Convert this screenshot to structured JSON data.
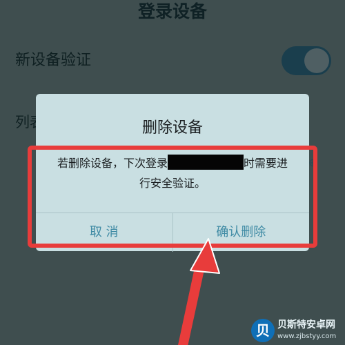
{
  "header": {
    "title": "登录设备"
  },
  "settings": {
    "new_device_verify_label": "新设备验证",
    "new_device_verify_on": true,
    "list_label": "列表"
  },
  "dialog": {
    "title": "删除设备",
    "message_part1": "若删除设备，下次登录",
    "message_part2": "时需要进",
    "message_line2": "行安全验证。",
    "cancel_label": "取 消",
    "confirm_label": "确认删除"
  },
  "watermark": {
    "logo_glyph": "贝",
    "name": "贝斯特安卓网",
    "url": "www.zjbstyy.com"
  },
  "colors": {
    "background": "#3f4e4f",
    "dialog": "#c9dfe2",
    "button_text": "#3e8aa4",
    "annotation_red": "#e83c3b"
  }
}
